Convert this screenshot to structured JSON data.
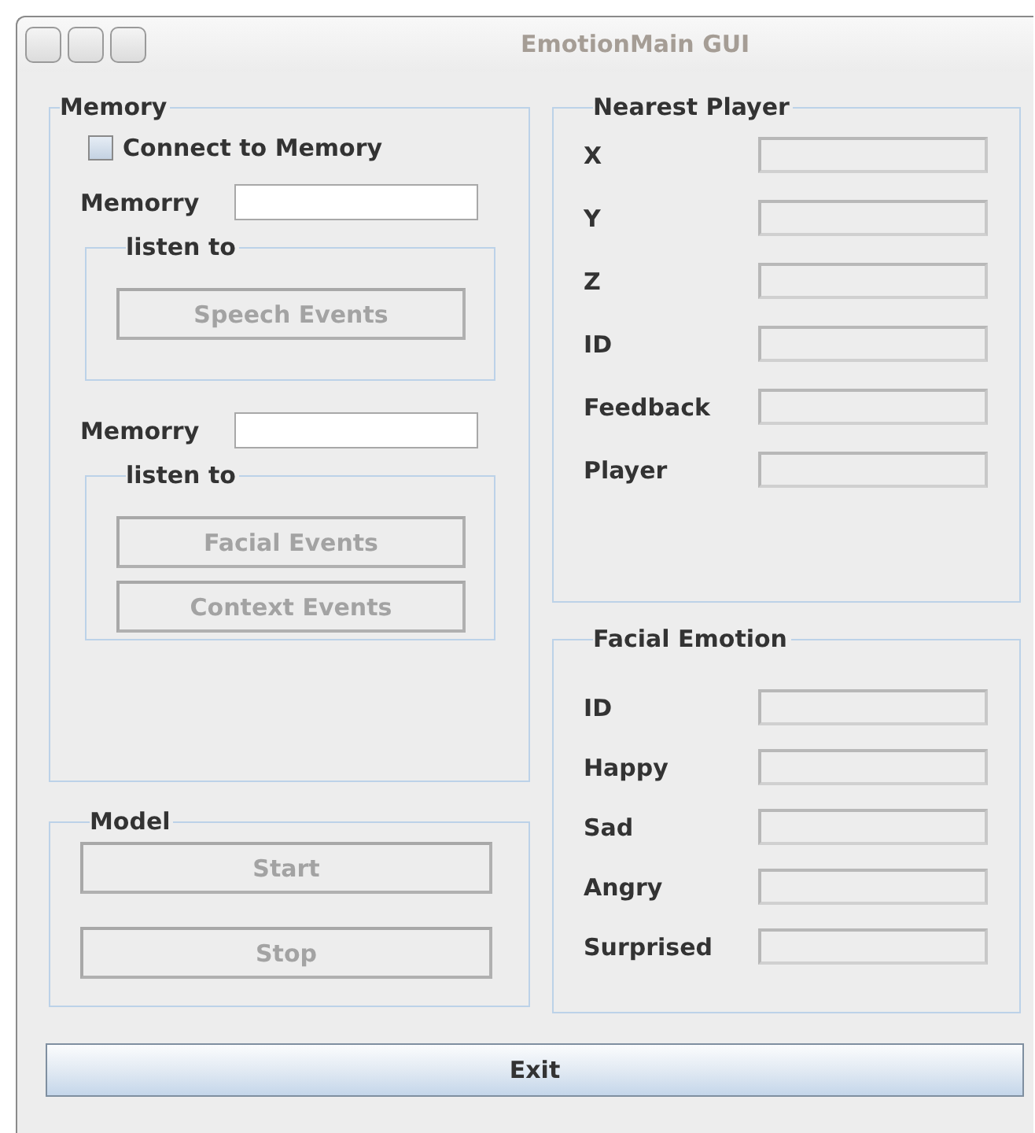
{
  "window": {
    "title": "EmotionMain GUI"
  },
  "memory": {
    "title": "Memory",
    "connect": {
      "label": "Connect to Memory",
      "checked": false
    },
    "groups": [
      {
        "field": {
          "label": "Memorry",
          "disabled": false
        },
        "listen": {
          "title": "listen to",
          "buttons": [
            {
              "label": "Speech Events",
              "disabled": true
            }
          ]
        }
      },
      {
        "field": {
          "label": "Memorry",
          "disabled": false
        },
        "listen": {
          "title": "listen to",
          "buttons": [
            {
              "label": "Facial Events",
              "disabled": true
            },
            {
              "label": "Context Events",
              "disabled": true
            }
          ]
        }
      }
    ]
  },
  "model": {
    "title": "Model",
    "buttons": [
      {
        "label": "Start",
        "disabled": true
      },
      {
        "label": "Stop",
        "disabled": true
      }
    ]
  },
  "nearest_player": {
    "title": "Nearest Player",
    "fields": [
      {
        "label": "X",
        "disabled": true
      },
      {
        "label": "Y",
        "disabled": true
      },
      {
        "label": "Z",
        "disabled": true
      },
      {
        "label": "ID",
        "disabled": true
      },
      {
        "label": "Feedback",
        "disabled": true
      },
      {
        "label": "Player",
        "disabled": true
      }
    ]
  },
  "facial_emotion": {
    "title": "Facial Emotion",
    "fields": [
      {
        "label": "ID",
        "disabled": true
      },
      {
        "label": "Happy",
        "disabled": true
      },
      {
        "label": "Sad",
        "disabled": true
      },
      {
        "label": "Angry",
        "disabled": true
      },
      {
        "label": "Surprised",
        "disabled": true
      }
    ]
  },
  "exit_button": {
    "label": "Exit",
    "disabled": false
  }
}
